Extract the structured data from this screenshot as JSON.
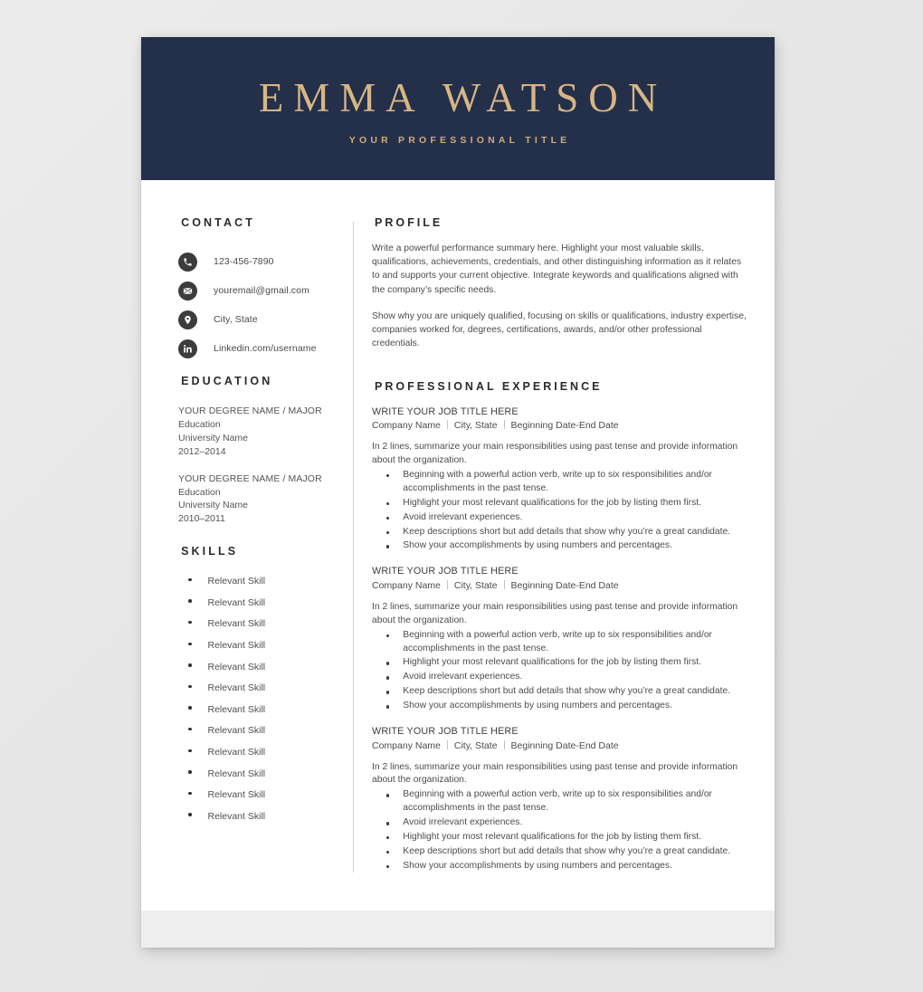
{
  "header": {
    "name": "EMMA WATSON",
    "subtitle": "YOUR PROFESSIONAL TITLE",
    "bg_color": "#242f4a",
    "accent_color": "#d7b684"
  },
  "sidebar": {
    "contact": {
      "title": "CONTACT",
      "items": [
        {
          "icon": "phone-icon",
          "value": "123-456-7890"
        },
        {
          "icon": "envelope-icon",
          "value": "youremail@gmail.com"
        },
        {
          "icon": "location-icon",
          "value": "City, State"
        },
        {
          "icon": "linkedin-icon",
          "value": "Linkedin.com/username"
        }
      ]
    },
    "education": {
      "title": "EDUCATION",
      "entries": [
        {
          "degree": "YOUR DEGREE NAME / MAJOR",
          "level": "Education",
          "school": "University Name",
          "years": "2012–2014"
        },
        {
          "degree": "YOUR DEGREE NAME / MAJOR",
          "level": "Education",
          "school": "University Name",
          "years": "2010–2011"
        }
      ]
    },
    "skills": {
      "title": "SKILLS",
      "items": [
        "Relevant Skill",
        "Relevant Skill",
        "Relevant Skill",
        "Relevant Skill",
        "Relevant Skill",
        "Relevant Skill",
        "Relevant Skill",
        "Relevant Skill",
        "Relevant Skill",
        "Relevant Skill",
        "Relevant Skill",
        "Relevant Skill"
      ]
    }
  },
  "main": {
    "profile": {
      "title": "PROFILE",
      "paragraphs": [
        "Write a powerful performance summary here. Highlight your most valuable skills, qualifications, achievements, credentials, and other distinguishing information as it relates to and supports your current objective. Integrate keywords and qualifications aligned with the company’s specific needs.",
        "Show why you are uniquely qualified, focusing on skills or qualifications, industry expertise, companies worked for, degrees, certifications, awards, and/or other professional credentials."
      ]
    },
    "experience": {
      "title": "PROFESSIONAL EXPERIENCE",
      "jobs": [
        {
          "title": "WRITE YOUR JOB TITLE HERE",
          "company": "Company Name",
          "location": "City, State",
          "dates": "Beginning Date-End Date",
          "summary": "In 2 lines, summarize your main responsibilities using past tense and provide information about the organization.",
          "bullets": [
            "Beginning with a powerful action verb, write up to six responsibilities and/or accomplishments in the past tense.",
            "Highlight your most relevant qualifications for the job by listing them first.",
            "Avoid irrelevant experiences.",
            "Keep descriptions short but add details that show why you’re a great candidate.",
            "Show your accomplishments by using numbers and percentages."
          ]
        },
        {
          "title": "WRITE YOUR JOB TITLE HERE",
          "company": "Company Name",
          "location": "City, State",
          "dates": "Beginning Date-End Date",
          "summary": "In 2 lines, summarize your main responsibilities using past tense and provide information about the organization.",
          "bullets": [
            "Beginning with a powerful action verb, write up to six responsibilities and/or accomplishments in the past tense.",
            "Highlight your most relevant qualifications for the job by listing them first.",
            "Avoid irrelevant experiences.",
            "Keep descriptions short but add details that show why you’re a great candidate.",
            "Show your accomplishments by using numbers and percentages."
          ]
        },
        {
          "title": "WRITE YOUR JOB TITLE HERE",
          "company": "Company Name",
          "location": "City, State",
          "dates": "Beginning Date-End Date",
          "summary": "In 2 lines, summarize your main responsibilities using past tense and provide information about the organization.",
          "bullets": [
            "Beginning with a powerful action verb, write up to six responsibilities and/or accomplishments in the past tense.",
            "Avoid irrelevant experiences.",
            "Highlight your most relevant qualifications for the job by listing them first.",
            "Keep descriptions short but add details that show why you’re a great candidate.",
            "Show your accomplishments by using numbers and percentages."
          ]
        }
      ]
    }
  }
}
